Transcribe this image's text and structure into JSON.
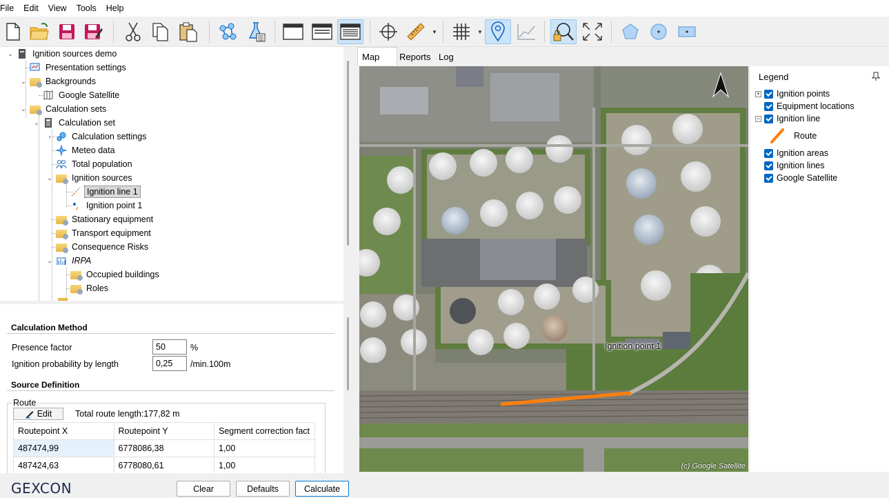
{
  "menu": [
    "File",
    "Edit",
    "View",
    "Tools",
    "Help"
  ],
  "toolbar": {
    "buttons": [
      "new-file-icon",
      "open-folder-icon",
      "save-icon",
      "save-as-icon",
      "cut-icon",
      "copy-icon",
      "paste-icon",
      "network-icon",
      "flask-calculator-icon",
      "window-icon",
      "window-list-icon",
      "window-detail-icon",
      "crosshair-icon",
      "ruler-icon",
      "grid-icon",
      "map-pin-icon",
      "line-chart-icon",
      "zoom-lock-icon",
      "fit-extent-icon",
      "pentagon-icon",
      "circle-icon",
      "rectangle-icon"
    ],
    "active": [
      "window-detail-icon",
      "map-pin-icon",
      "zoom-lock-icon"
    ]
  },
  "tree": {
    "items": [
      {
        "label": "Ignition sources demo",
        "icon": "project-icon"
      },
      {
        "label": "Presentation settings",
        "icon": "presentation-icon"
      },
      {
        "label": "Backgrounds",
        "icon": "folder-icon"
      },
      {
        "label": "Google Satellite",
        "icon": "map-layer-icon"
      },
      {
        "label": "Calculation sets",
        "icon": "folder-icon"
      },
      {
        "label": "Calculation set",
        "icon": "calculator-icon"
      },
      {
        "label": "Calculation settings",
        "icon": "gears-icon"
      },
      {
        "label": "Meteo data",
        "icon": "compass-icon"
      },
      {
        "label": "Total population",
        "icon": "people-icon"
      },
      {
        "label": "Ignition sources",
        "icon": "folder-icon"
      },
      {
        "label": "Ignition line 1",
        "icon": "ignition-line-icon"
      },
      {
        "label": "Ignition point 1",
        "icon": "ignition-point-icon"
      },
      {
        "label": "Stationary equipment",
        "icon": "folder-icon"
      },
      {
        "label": "Transport equipment",
        "icon": "folder-icon"
      },
      {
        "label": "Consequence Risks",
        "icon": "folder-icon"
      },
      {
        "label": "IRPA",
        "icon": "irpa-icon"
      },
      {
        "label": "Occupied buildings",
        "icon": "folder-icon"
      },
      {
        "label": "Roles",
        "icon": "folder-icon"
      }
    ],
    "selected": "Ignition line 1"
  },
  "properties": {
    "calc_method_title": "Calculation Method",
    "presence_label": "Presence factor",
    "presence_value": "50",
    "presence_unit": "%",
    "ignition_label": "Ignition probability by length",
    "ignition_value": "0,25",
    "ignition_unit": "/min.100m",
    "source_def_title": "Source Definition",
    "route_label": "Route",
    "edit_label": "Edit",
    "route_length": "Total route length:177,82  m",
    "columns": [
      "Routepoint X",
      "Routepoint Y",
      "Segment correction fact"
    ],
    "rows": [
      [
        "487474,99",
        "6778086,38",
        "1,00"
      ],
      [
        "487424,63",
        "6778080,61",
        "1,00"
      ]
    ]
  },
  "bottom": {
    "logo": "GEXCON",
    "clear": "Clear",
    "defaults": "Defaults",
    "calculate": "Calculate"
  },
  "tabs": [
    "Map",
    "Reports",
    "Log"
  ],
  "active_tab": "Map",
  "map": {
    "point_label": "Ignition point 1",
    "copyright": "(c) Google Satellite",
    "route_color": "#ff7f0e"
  },
  "legend": {
    "title": "Legend",
    "items": [
      {
        "label": "Ignition points",
        "checked": true,
        "expander": "+"
      },
      {
        "label": "Equipment locations",
        "checked": true
      },
      {
        "label": "Ignition line",
        "checked": true,
        "expander": "-"
      },
      {
        "label": "Route",
        "swatch": "#ff7f0e"
      },
      {
        "label": "Ignition areas",
        "checked": true
      },
      {
        "label": "Ignition lines",
        "checked": true
      },
      {
        "label": "Google Satellite",
        "checked": true
      }
    ]
  }
}
